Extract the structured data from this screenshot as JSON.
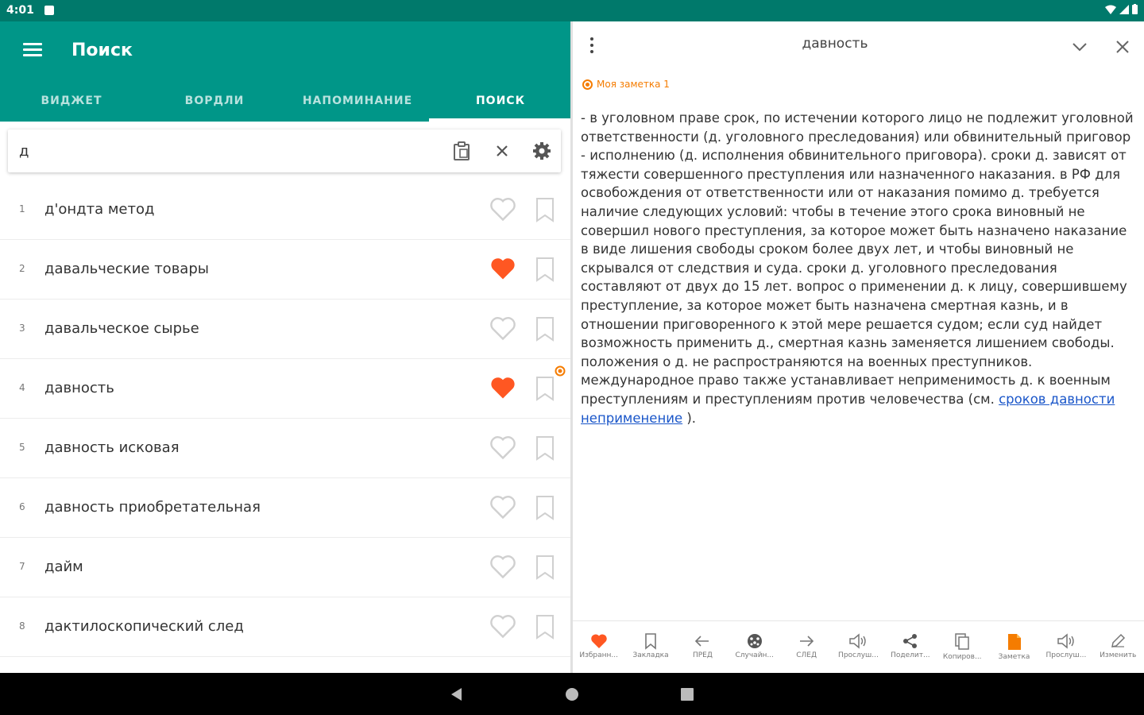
{
  "status_bar": {
    "time": "4:01"
  },
  "app_bar": {
    "title": "Поиск"
  },
  "tabs": [
    {
      "label": "ВИДЖЕТ"
    },
    {
      "label": "ВОРДЛИ"
    },
    {
      "label": "НАПОМИНАНИЕ"
    },
    {
      "label": "ПОИСК"
    }
  ],
  "search": {
    "value": "д",
    "placeholder": ""
  },
  "results": [
    {
      "num": "1",
      "word": "д'ондта метод",
      "favorite": false
    },
    {
      "num": "2",
      "word": "давальческие товары",
      "favorite": true
    },
    {
      "num": "3",
      "word": "давальческое сырье",
      "favorite": false
    },
    {
      "num": "4",
      "word": "давность",
      "favorite": true
    },
    {
      "num": "5",
      "word": "давность исковая",
      "favorite": false
    },
    {
      "num": "6",
      "word": "давность приобретательная",
      "favorite": false
    },
    {
      "num": "7",
      "word": "дайм",
      "favorite": false
    },
    {
      "num": "8",
      "word": "дактилоскопический след",
      "favorite": false
    }
  ],
  "detail": {
    "title": "давность",
    "note_label": "Моя заметка 1",
    "definition": "  - в уголовном праве срок, по истечении которого лицо не подлежит уголовной ответственности (д. уголовного преследования) или обвинительный приговор - исполнению (д. исполнения обвинительного приговора). сроки д. зависят от тяжести совершенного преступления или назначенного наказания. в РФ для освобождения от ответственности или от наказания помимо д. требуется наличие следующих условий: чтобы в течение этого срока виновный не совершил нового преступления, за которое может быть назначено наказание в виде лишения свободы сроком более двух лет, и чтобы виновный не скрывался от следствия и суда. сроки д. уголовного преследования составляют от двух до 15 лет. вопрос о применении д. к лицу, совершившему преступление, за которое может быть назначена смертная казнь, и в отношении приговоренного к этой мере решается судом; если суд найдет возможность применить д., смертная казнь заменяется лишением свободы. положения о д. не распространяются на военных преступников. международное право также устанавливает неприменимость д. к военным преступлениям и преступлениям против человечества (см. ",
    "link_text": "сроков давности неприменение",
    "after_link": " )."
  },
  "toolbar": [
    {
      "label": "Избранн...",
      "icon": "heart-icon"
    },
    {
      "label": "Закладка",
      "icon": "bookmark-icon"
    },
    {
      "label": "ПРЕД",
      "icon": "arrow-left-icon"
    },
    {
      "label": "Случайн...",
      "icon": "dice-icon"
    },
    {
      "label": "СЛЕД",
      "icon": "arrow-right-icon"
    },
    {
      "label": "Прослуш...",
      "icon": "speaker-icon"
    },
    {
      "label": "Поделит...",
      "icon": "share-icon"
    },
    {
      "label": "Копиров...",
      "icon": "copy-icon"
    },
    {
      "label": "Заметка",
      "icon": "note-icon"
    },
    {
      "label": "Прослуш...",
      "icon": "speaker-icon"
    },
    {
      "label": "Изменить",
      "icon": "pencil-icon"
    }
  ],
  "colors": {
    "primary": "#009688",
    "primary_dark": "#00796b",
    "favorite": "#ff5722",
    "note_accent": "#f57c00",
    "link": "#1a56c9"
  }
}
